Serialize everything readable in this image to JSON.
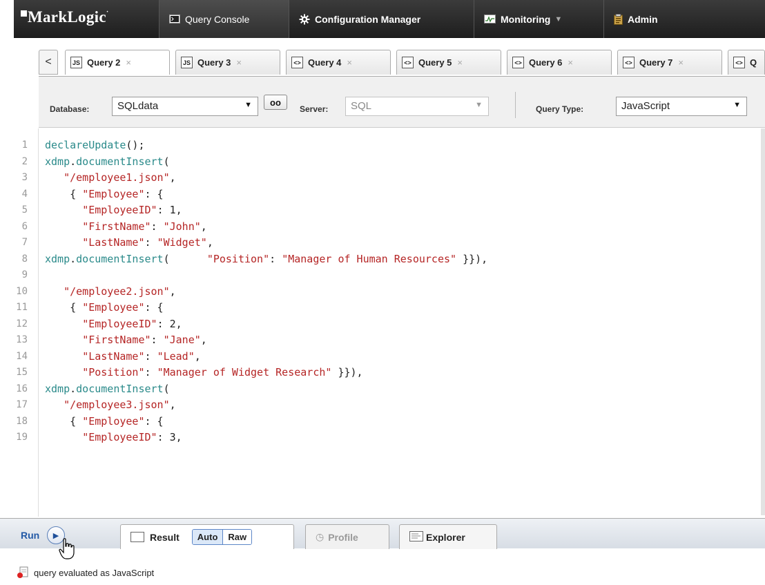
{
  "app": {
    "logo": "MarkLogic",
    "nav": [
      {
        "label": "Query Console"
      },
      {
        "label": "Configuration Manager"
      },
      {
        "label": "Monitoring"
      },
      {
        "label": "Admin"
      }
    ]
  },
  "query_tabs": {
    "back_symbol": "<",
    "close_symbol": "×",
    "tabs": [
      {
        "label": "Query 2",
        "icon": "JS"
      },
      {
        "label": "Query 3",
        "icon": "JS"
      },
      {
        "label": "Query 4",
        "icon": "<>"
      },
      {
        "label": "Query 5",
        "icon": "<>"
      },
      {
        "label": "Query 6",
        "icon": "<>"
      },
      {
        "label": "Query 7",
        "icon": "<>"
      },
      {
        "label": "Q",
        "icon": "<>"
      }
    ]
  },
  "settings": {
    "database_label": "Database:",
    "database_value": "SQLdata",
    "server_label": "Server:",
    "server_value": "SQL",
    "query_type_label": "Query Type:",
    "query_type_value": "JavaScript"
  },
  "editor": {
    "line_numbers": [
      "1",
      "2",
      "3",
      "4",
      "5",
      "6",
      "7",
      "8",
      "9",
      "10",
      "11",
      "12",
      "13",
      "14",
      "15",
      "16",
      "17",
      "18",
      "19"
    ],
    "lines": [
      [
        {
          "t": "fn",
          "v": "declareUpdate"
        },
        {
          "t": "p",
          "v": "();"
        }
      ],
      [
        {
          "t": "fn",
          "v": "xdmp"
        },
        {
          "t": "p",
          "v": "."
        },
        {
          "t": "fn",
          "v": "documentInsert"
        },
        {
          "t": "p",
          "v": "("
        }
      ],
      [
        {
          "t": "p",
          "v": "   "
        },
        {
          "t": "str",
          "v": "\"/employee1.json\""
        },
        {
          "t": "p",
          "v": ","
        }
      ],
      [
        {
          "t": "p",
          "v": "    { "
        },
        {
          "t": "str",
          "v": "\"Employee\""
        },
        {
          "t": "p",
          "v": ": {"
        }
      ],
      [
        {
          "t": "p",
          "v": "      "
        },
        {
          "t": "str",
          "v": "\"EmployeeID\""
        },
        {
          "t": "p",
          "v": ": 1,"
        }
      ],
      [
        {
          "t": "p",
          "v": "      "
        },
        {
          "t": "str",
          "v": "\"FirstName\""
        },
        {
          "t": "p",
          "v": ": "
        },
        {
          "t": "str",
          "v": "\"John\""
        },
        {
          "t": "p",
          "v": ","
        }
      ],
      [
        {
          "t": "p",
          "v": "      "
        },
        {
          "t": "str",
          "v": "\"LastName\""
        },
        {
          "t": "p",
          "v": ": "
        },
        {
          "t": "str",
          "v": "\"Widget\""
        },
        {
          "t": "p",
          "v": ","
        }
      ],
      [
        {
          "t": "fn",
          "v": "xdmp"
        },
        {
          "t": "p",
          "v": "."
        },
        {
          "t": "fn",
          "v": "documentInsert"
        },
        {
          "t": "p",
          "v": "(      "
        },
        {
          "t": "str",
          "v": "\"Position\""
        },
        {
          "t": "p",
          "v": ": "
        },
        {
          "t": "str",
          "v": "\"Manager of Human Resources\""
        },
        {
          "t": "p",
          "v": " }}),"
        }
      ],
      [],
      [
        {
          "t": "p",
          "v": "   "
        },
        {
          "t": "str",
          "v": "\"/employee2.json\""
        },
        {
          "t": "p",
          "v": ","
        }
      ],
      [
        {
          "t": "p",
          "v": "    { "
        },
        {
          "t": "str",
          "v": "\"Employee\""
        },
        {
          "t": "p",
          "v": ": {"
        }
      ],
      [
        {
          "t": "p",
          "v": "      "
        },
        {
          "t": "str",
          "v": "\"EmployeeID\""
        },
        {
          "t": "p",
          "v": ": 2,"
        }
      ],
      [
        {
          "t": "p",
          "v": "      "
        },
        {
          "t": "str",
          "v": "\"FirstName\""
        },
        {
          "t": "p",
          "v": ": "
        },
        {
          "t": "str",
          "v": "\"Jane\""
        },
        {
          "t": "p",
          "v": ","
        }
      ],
      [
        {
          "t": "p",
          "v": "      "
        },
        {
          "t": "str",
          "v": "\"LastName\""
        },
        {
          "t": "p",
          "v": ": "
        },
        {
          "t": "str",
          "v": "\"Lead\""
        },
        {
          "t": "p",
          "v": ","
        }
      ],
      [
        {
          "t": "p",
          "v": "      "
        },
        {
          "t": "str",
          "v": "\"Position\""
        },
        {
          "t": "p",
          "v": ": "
        },
        {
          "t": "str",
          "v": "\"Manager of Widget Research\""
        },
        {
          "t": "p",
          "v": " }}),"
        }
      ],
      [
        {
          "t": "fn",
          "v": "xdmp"
        },
        {
          "t": "p",
          "v": "."
        },
        {
          "t": "fn",
          "v": "documentInsert"
        },
        {
          "t": "p",
          "v": "("
        }
      ],
      [
        {
          "t": "p",
          "v": "   "
        },
        {
          "t": "str",
          "v": "\"/employee3.json\""
        },
        {
          "t": "p",
          "v": ","
        }
      ],
      [
        {
          "t": "p",
          "v": "    { "
        },
        {
          "t": "str",
          "v": "\"Employee\""
        },
        {
          "t": "p",
          "v": ": {"
        }
      ],
      [
        {
          "t": "p",
          "v": "      "
        },
        {
          "t": "str",
          "v": "\"EmployeeID\""
        },
        {
          "t": "p",
          "v": ": 3,"
        }
      ]
    ]
  },
  "bottom": {
    "run_label": "Run",
    "result_label": "Result",
    "auto_label": "Auto",
    "raw_label": "Raw",
    "profile_label": "Profile",
    "explorer_label": "Explorer"
  },
  "status": {
    "message": "query evaluated as JavaScript"
  },
  "colors": {
    "function": "#2a8a8a",
    "string": "#b52525",
    "run_blue": "#2259a6"
  }
}
